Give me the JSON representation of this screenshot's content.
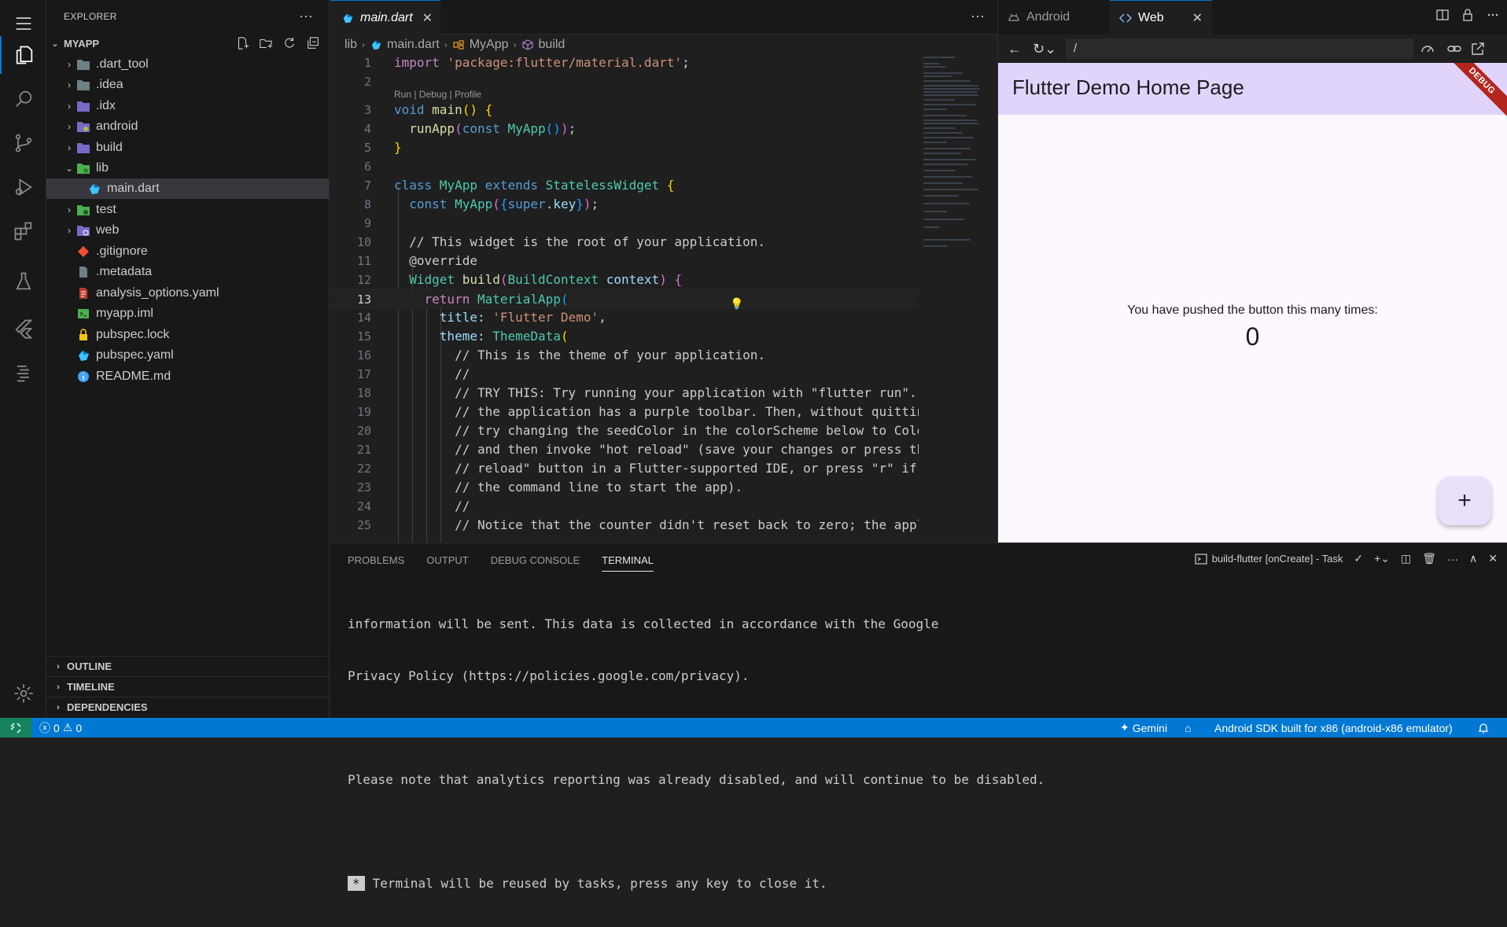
{
  "sidebar": {
    "title": "EXPLORER",
    "root": "MYAPP",
    "items": [
      {
        "label": ".dart_tool",
        "kind": "folder",
        "expanded": false
      },
      {
        "label": ".idea",
        "kind": "folder",
        "expanded": false
      },
      {
        "label": ".idx",
        "kind": "folder",
        "expanded": false
      },
      {
        "label": "android",
        "kind": "folder-android",
        "expanded": false
      },
      {
        "label": "build",
        "kind": "folder",
        "expanded": false
      },
      {
        "label": "lib",
        "kind": "folder-lib",
        "expanded": true
      },
      {
        "label": "main.dart",
        "kind": "dart",
        "selected": true
      },
      {
        "label": "test",
        "kind": "folder-test",
        "expanded": false
      },
      {
        "label": "web",
        "kind": "folder-web",
        "expanded": false
      },
      {
        "label": ".gitignore",
        "kind": "git"
      },
      {
        "label": ".metadata",
        "kind": "file"
      },
      {
        "label": "analysis_options.yaml",
        "kind": "yaml"
      },
      {
        "label": "myapp.iml",
        "kind": "iml"
      },
      {
        "label": "pubspec.lock",
        "kind": "lock"
      },
      {
        "label": "pubspec.yaml",
        "kind": "dart"
      },
      {
        "label": "README.md",
        "kind": "info"
      }
    ],
    "outline": "OUTLINE",
    "timeline": "TIMELINE",
    "dependencies": "DEPENDENCIES"
  },
  "editor": {
    "tab": "main.dart",
    "breadcrumb": [
      "lib",
      "main.dart",
      "MyApp",
      "build"
    ],
    "codelens": "Run | Debug | Profile",
    "lines": [
      "1",
      "2",
      "3",
      "4",
      "5",
      "6",
      "7",
      "8",
      "9",
      "10",
      "11",
      "12",
      "13",
      "14",
      "15",
      "16",
      "17",
      "18",
      "19",
      "20",
      "21",
      "22",
      "23",
      "24",
      "25"
    ],
    "code": {
      "l1a": "import ",
      "l1b": "'package:flutter/material.dart'",
      "l1c": ";",
      "l3a": "void ",
      "l3b": "main",
      "l3c": "() ",
      "l3d": "{",
      "l4a": "  runApp",
      "l4b": "(",
      "l4c": "const ",
      "l4d": "MyApp",
      "l4e": "()",
      "l4f": ")",
      "l4g": ";",
      "l5": "}",
      "l7a": "class ",
      "l7b": "MyApp ",
      "l7c": "extends ",
      "l7d": "StatelessWidget ",
      "l7e": "{",
      "l8a": "  const ",
      "l8b": "MyApp",
      "l8c": "(",
      "l8d": "{",
      "l8e": "super",
      "l8f": ".key",
      "l8g": "}",
      "l8h": ")",
      "l8i": ";",
      "l10": "  // This widget is the root of your application.",
      "l11": "  @override",
      "l12a": "  Widget ",
      "l12b": "build",
      "l12c": "(",
      "l12d": "BuildContext ",
      "l12e": "context",
      "l12f": ") ",
      "l12g": "{",
      "l13a": "    return ",
      "l13b": "MaterialApp",
      "l13c": "(",
      "l14a": "      title: ",
      "l14b": "'Flutter Demo'",
      "l14c": ",",
      "l15a": "      theme: ",
      "l15b": "ThemeData",
      "l15c": "(",
      "l16": "        // This is the theme of your application.",
      "l17": "        //",
      "l18": "        // TRY THIS: Try running your application with \"flutter run\". Yo",
      "l19": "        // the application has a purple toolbar. Then, without quitting",
      "l20": "        // try changing the seedColor in the colorScheme below to Colors",
      "l21": "        // and then invoke \"hot reload\" (save your changes or press the",
      "l22": "        // reload\" button in a Flutter-supported IDE, or press \"r\" if yo",
      "l23": "        // the command line to start the app).",
      "l24": "        //",
      "l25": "        // Notice that the counter didn't reset back to zero; the applic"
    }
  },
  "preview": {
    "tabs": [
      "Android",
      "Web"
    ],
    "url": "/",
    "app_title": "Flutter Demo Home Page",
    "debug_banner": "DEBUG",
    "counter_message": "You have pushed the button this many times:",
    "counter_value": "0",
    "fab_label": "+",
    "appbar_color": "#e0d4fb",
    "background_color": "#fdf7ff"
  },
  "panel": {
    "tabs": [
      "PROBLEMS",
      "OUTPUT",
      "DEBUG CONSOLE",
      "TERMINAL"
    ],
    "active_tab": "TERMINAL",
    "task": "build-flutter [onCreate] - Task",
    "terminal_lines": [
      "information will be sent. This data is collected in accordance with the Google",
      "Privacy Policy (https://policies.google.com/privacy).",
      "",
      "Please note that analytics reporting was already disabled, and will continue to be disabled."
    ],
    "terminal_star": "*",
    "terminal_reuse": "Terminal will be reused by tasks, press any key to close it."
  },
  "status": {
    "errors": "0",
    "warnings": "0",
    "gemini": "Gemini",
    "device": "Android SDK built for x86 (android-x86 emulator)",
    "accent": "#0078d4",
    "remote_color": "#16825d"
  }
}
